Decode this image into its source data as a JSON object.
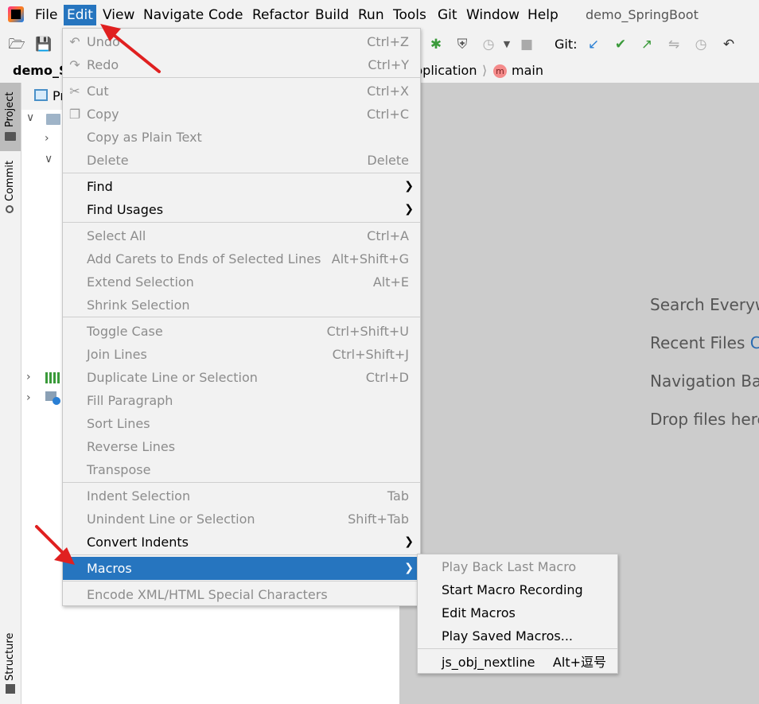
{
  "menubar": {
    "items": [
      "File",
      "Edit",
      "View",
      "Navigate",
      "Code",
      "Refactor",
      "Build",
      "Run",
      "Tools",
      "Git",
      "Window",
      "Help"
    ],
    "title": "demo_SpringBoot"
  },
  "toolbar": {
    "git_label": "Git:"
  },
  "navbar": {
    "project_tab": "demo_S",
    "crumb_class": "pplication",
    "crumb_method": "main",
    "method_badge": "m"
  },
  "leftstrip": {
    "project": "Project",
    "commit": "Commit",
    "structure": "Structure"
  },
  "project_panel": {
    "header": "Pr"
  },
  "editor_hints": [
    {
      "text": "Search Everyw",
      "key": ""
    },
    {
      "text": "Recent Files ",
      "key": "Ct"
    },
    {
      "text": "Navigation Bar",
      "key": ""
    },
    {
      "text": "Drop files here",
      "key": ""
    }
  ],
  "edit_menu": {
    "items": [
      {
        "label": "Undo",
        "shortcut": "Ctrl+Z",
        "disabled": true,
        "icon": "undo-icon"
      },
      {
        "label": "Redo",
        "shortcut": "Ctrl+Y",
        "disabled": true,
        "icon": "redo-icon"
      },
      {
        "label": "Cut",
        "shortcut": "Ctrl+X",
        "disabled": true,
        "icon": "cut-icon"
      },
      {
        "label": "Copy",
        "shortcut": "Ctrl+C",
        "disabled": true,
        "icon": "copy-icon"
      },
      {
        "label": "Copy as Plain Text",
        "shortcut": "",
        "disabled": true
      },
      {
        "label": "Delete",
        "shortcut": "Delete",
        "disabled": true
      },
      {
        "label": "Find",
        "shortcut": "",
        "disabled": false,
        "submenu": true
      },
      {
        "label": "Find Usages",
        "shortcut": "",
        "disabled": false,
        "submenu": true
      },
      {
        "label": "Select All",
        "shortcut": "Ctrl+A",
        "disabled": true
      },
      {
        "label": "Add Carets to Ends of Selected Lines",
        "shortcut": "Alt+Shift+G",
        "disabled": true
      },
      {
        "label": "Extend Selection",
        "shortcut": "Alt+E",
        "disabled": true
      },
      {
        "label": "Shrink Selection",
        "shortcut": "",
        "disabled": true
      },
      {
        "label": "Toggle Case",
        "shortcut": "Ctrl+Shift+U",
        "disabled": true
      },
      {
        "label": "Join Lines",
        "shortcut": "Ctrl+Shift+J",
        "disabled": true
      },
      {
        "label": "Duplicate Line or Selection",
        "shortcut": "Ctrl+D",
        "disabled": true
      },
      {
        "label": "Fill Paragraph",
        "shortcut": "",
        "disabled": true
      },
      {
        "label": "Sort Lines",
        "shortcut": "",
        "disabled": true
      },
      {
        "label": "Reverse Lines",
        "shortcut": "",
        "disabled": true
      },
      {
        "label": "Transpose",
        "shortcut": "",
        "disabled": true
      },
      {
        "label": "Indent Selection",
        "shortcut": "Tab",
        "disabled": true
      },
      {
        "label": "Unindent Line or Selection",
        "shortcut": "Shift+Tab",
        "disabled": true
      },
      {
        "label": "Convert Indents",
        "shortcut": "",
        "disabled": false,
        "submenu": true
      },
      {
        "label": "Macros",
        "shortcut": "",
        "disabled": false,
        "submenu": true,
        "highlighted": true
      },
      {
        "label": "Encode XML/HTML Special Characters",
        "shortcut": "",
        "disabled": true
      }
    ]
  },
  "macros_menu": {
    "items": [
      {
        "label": "Play Back Last Macro",
        "shortcut": "",
        "disabled": true
      },
      {
        "label": "Start Macro Recording",
        "shortcut": "",
        "disabled": false
      },
      {
        "label": "Edit Macros",
        "shortcut": "",
        "disabled": false
      },
      {
        "label": "Play Saved Macros...",
        "shortcut": "",
        "disabled": false
      },
      {
        "label": "js_obj_nextline",
        "shortcut": "Alt+逗号",
        "disabled": false
      }
    ]
  },
  "colors": {
    "highlight": "#2675bf",
    "annotation_arrow": "#e02020",
    "editor_bg": "#cccccc"
  }
}
